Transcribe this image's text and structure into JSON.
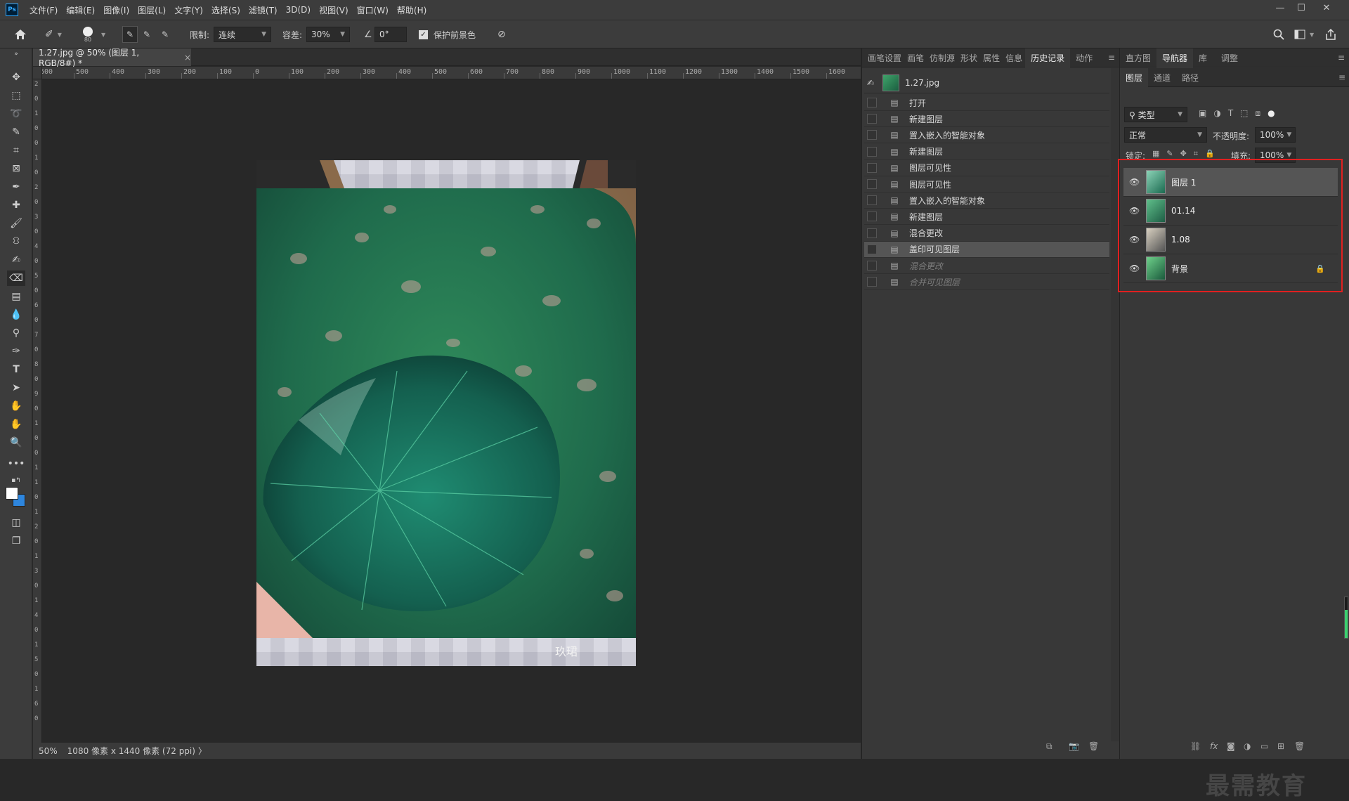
{
  "app": {
    "logo": "Ps"
  },
  "menu": [
    "文件(F)",
    "编辑(E)",
    "图像(I)",
    "图层(L)",
    "文字(Y)",
    "选择(S)",
    "滤镜(T)",
    "3D(D)",
    "视图(V)",
    "窗口(W)",
    "帮助(H)"
  ],
  "window_controls": {
    "minimize": "—",
    "maximize": "☐",
    "close": "✕"
  },
  "options": {
    "brush_size": "80",
    "limit_label": "限制:",
    "limit_value": "连续",
    "tolerance_label": "容差:",
    "tolerance_value": "30%",
    "angle_value": "0°",
    "protect_fg_label": "保护前景色",
    "protect_fg_checked": true
  },
  "document": {
    "tab_title": "1.27.jpg @ 50% (图层 1, RGB/8#) *",
    "close": "×"
  },
  "ruler_h": [
    "600",
    "500",
    "400",
    "300",
    "200",
    "100",
    "0",
    "100",
    "200",
    "300",
    "400",
    "500",
    "600",
    "700",
    "800",
    "900",
    "1000",
    "1100",
    "1200",
    "1300",
    "1400",
    "1500",
    "1600"
  ],
  "ruler_v": [
    "2",
    "0",
    "1",
    "0",
    "0",
    "1",
    "0",
    "2",
    "0",
    "3",
    "0",
    "4",
    "0",
    "5",
    "0",
    "6",
    "0",
    "7",
    "0",
    "8",
    "0",
    "9",
    "0",
    "1",
    "0",
    "0",
    "1",
    "1",
    "0",
    "1",
    "2",
    "0",
    "1",
    "3",
    "0",
    "1",
    "4",
    "0",
    "1",
    "5",
    "0",
    "1",
    "6",
    "0"
  ],
  "status": {
    "zoom": "50%",
    "info": "1080 像素 x 1440 像素 (72 ppi)",
    "arrow": "〉"
  },
  "canvas": {
    "signature": "玖珺"
  },
  "history_panel": {
    "tabs": [
      "画笔设置",
      "画笔",
      "仿制源",
      "形状",
      "属性",
      "信息",
      "历史记录",
      "动作"
    ],
    "active_tab": "历史记录",
    "snapshot": "1.27.jpg",
    "items": [
      {
        "label": "打开",
        "state": "normal"
      },
      {
        "label": "新建图层",
        "state": "normal"
      },
      {
        "label": "置入嵌入的智能对象",
        "state": "normal"
      },
      {
        "label": "新建图层",
        "state": "normal"
      },
      {
        "label": "图层可见性",
        "state": "normal"
      },
      {
        "label": "图层可见性",
        "state": "normal"
      },
      {
        "label": "置入嵌入的智能对象",
        "state": "normal"
      },
      {
        "label": "新建图层",
        "state": "normal"
      },
      {
        "label": "混合更改",
        "state": "normal"
      },
      {
        "label": "盖印可见图层",
        "state": "selected"
      },
      {
        "label": "混合更改",
        "state": "dim"
      },
      {
        "label": "合并可见图层",
        "state": "dim"
      }
    ]
  },
  "right_top_tabs": [
    "直方图",
    "导航器",
    "库",
    "调整"
  ],
  "right_top_active": "导航器",
  "layers_panel": {
    "tabs": [
      "图层",
      "通道",
      "路径"
    ],
    "active_tab": "图层",
    "filter_label": "类型",
    "blend_mode": "正常",
    "opacity_label": "不透明度:",
    "opacity": "100%",
    "lock_label": "锁定:",
    "fill_label": "填充:",
    "fill": "100%",
    "layers": [
      {
        "name": "图层 1",
        "selected": true,
        "locked": false
      },
      {
        "name": "01.14",
        "selected": false,
        "locked": false
      },
      {
        "name": "1.08",
        "selected": false,
        "locked": false
      },
      {
        "name": "背景",
        "selected": false,
        "locked": true
      }
    ],
    "highlight_color": "#e02020"
  },
  "watermark": "最需教育"
}
